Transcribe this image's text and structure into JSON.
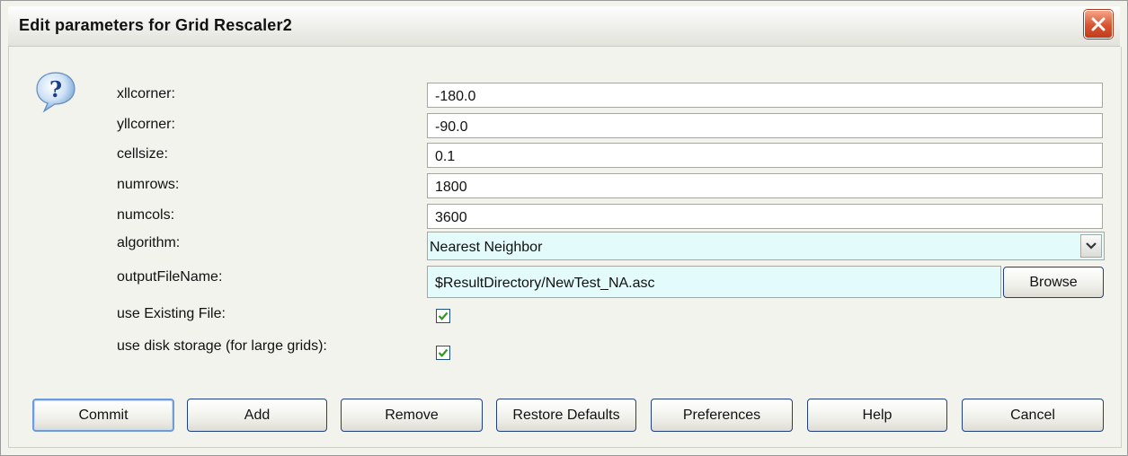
{
  "window": {
    "title": "Edit parameters for Grid Rescaler2"
  },
  "params": {
    "xllcorner": {
      "label": "xllcorner:",
      "value": "-180.0"
    },
    "yllcorner": {
      "label": "yllcorner:",
      "value": "-90.0"
    },
    "cellsize": {
      "label": "cellsize:",
      "value": "0.1"
    },
    "numrows": {
      "label": "numrows:",
      "value": "1800"
    },
    "numcols": {
      "label": "numcols:",
      "value": "3600"
    },
    "algorithm": {
      "label": "algorithm:",
      "value": "Nearest Neighbor"
    },
    "outputFileName": {
      "label": "outputFileName:",
      "value": "$ResultDirectory/NewTest_NA.asc",
      "browse_label": "Browse"
    },
    "useExistingFile": {
      "label": "use Existing File:",
      "checked": true
    },
    "useDiskStorage": {
      "label": "use disk storage (for large grids):",
      "checked": true
    }
  },
  "buttons": {
    "commit": "Commit",
    "add": "Add",
    "remove": "Remove",
    "restore_defaults": "Restore Defaults",
    "preferences": "Preferences",
    "help": "Help",
    "cancel": "Cancel"
  },
  "icons": {
    "help": "question-icon",
    "close": "close-icon",
    "dropdown": "chevron-down-icon",
    "check": "checkmark-icon"
  },
  "colors": {
    "accent_field_bg": "#e3fbfb",
    "close_button": "#d9532f",
    "check": "#2c9a1f"
  }
}
